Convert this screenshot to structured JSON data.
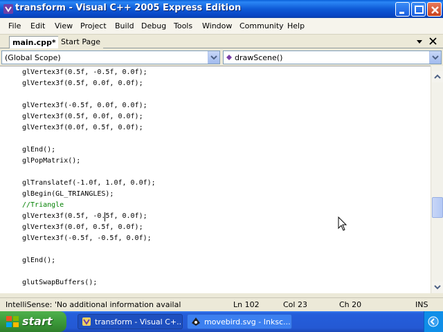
{
  "window": {
    "title": "transform - Visual C++ 2005 Express Edition"
  },
  "menu": {
    "items": [
      "File",
      "Edit",
      "View",
      "Project",
      "Build",
      "Debug",
      "Tools",
      "Window",
      "Community",
      "Help"
    ]
  },
  "tabs": {
    "items": [
      {
        "label": "main.cpp*",
        "active": true
      },
      {
        "label": "Start Page",
        "active": false
      }
    ]
  },
  "nav": {
    "scope": "(Global Scope)",
    "function": "drawScene()"
  },
  "code": {
    "lines": [
      {
        "text": "glVertex3f(0.5f, -0.5f, 0.0f);",
        "kind": "code"
      },
      {
        "text": "glVertex3f(0.5f, 0.0f, 0.0f);",
        "kind": "code"
      },
      {
        "text": "",
        "kind": "blank"
      },
      {
        "text": "glVertex3f(-0.5f, 0.0f, 0.0f);",
        "kind": "code"
      },
      {
        "text": "glVertex3f(0.5f, 0.0f, 0.0f);",
        "kind": "code"
      },
      {
        "text": "glVertex3f(0.0f, 0.5f, 0.0f);",
        "kind": "code"
      },
      {
        "text": "",
        "kind": "blank"
      },
      {
        "text": "glEnd();",
        "kind": "code"
      },
      {
        "text": "glPopMatrix();",
        "kind": "code"
      },
      {
        "text": "",
        "kind": "blank"
      },
      {
        "text": "glTranslatef(-1.0f, 1.0f, 0.0f);",
        "kind": "code"
      },
      {
        "text": "glBegin(GL_TRIANGLES);",
        "kind": "code"
      },
      {
        "text": "//Triangle",
        "kind": "comment"
      },
      {
        "text": "glVertex3f(0.5f, -0.5f, 0.0f);",
        "kind": "code"
      },
      {
        "text": "glVertex3f(0.0f, 0.5f, 0.0f);",
        "kind": "code"
      },
      {
        "text": "glVertex3f(-0.5f, -0.5f, 0.0f);",
        "kind": "code"
      },
      {
        "text": "",
        "kind": "blank"
      },
      {
        "text": "glEnd();",
        "kind": "code"
      },
      {
        "text": "",
        "kind": "blank"
      },
      {
        "text": "glutSwapBuffers();",
        "kind": "code"
      }
    ]
  },
  "status": {
    "message": "IntelliSense: 'No additional information availal",
    "line": "Ln 102",
    "col": "Col 23",
    "ch": "Ch 20",
    "mode": "INS"
  },
  "taskbar": {
    "start": "start",
    "tasks": [
      {
        "label": "transform - Visual C+...",
        "active": true
      },
      {
        "label": "movebird.svg - Inksc...",
        "active": false
      }
    ]
  },
  "colors": {
    "titlebar": "#0e5ad6",
    "comment": "#008000",
    "start": "#3c9a3a"
  },
  "icons": [
    "vs-app-icon",
    "minimize-icon",
    "maximize-icon",
    "close-icon",
    "pin-icon",
    "chevron-down-icon",
    "windows-logo-icon",
    "inkscape-icon",
    "tray-arrow-icon"
  ]
}
